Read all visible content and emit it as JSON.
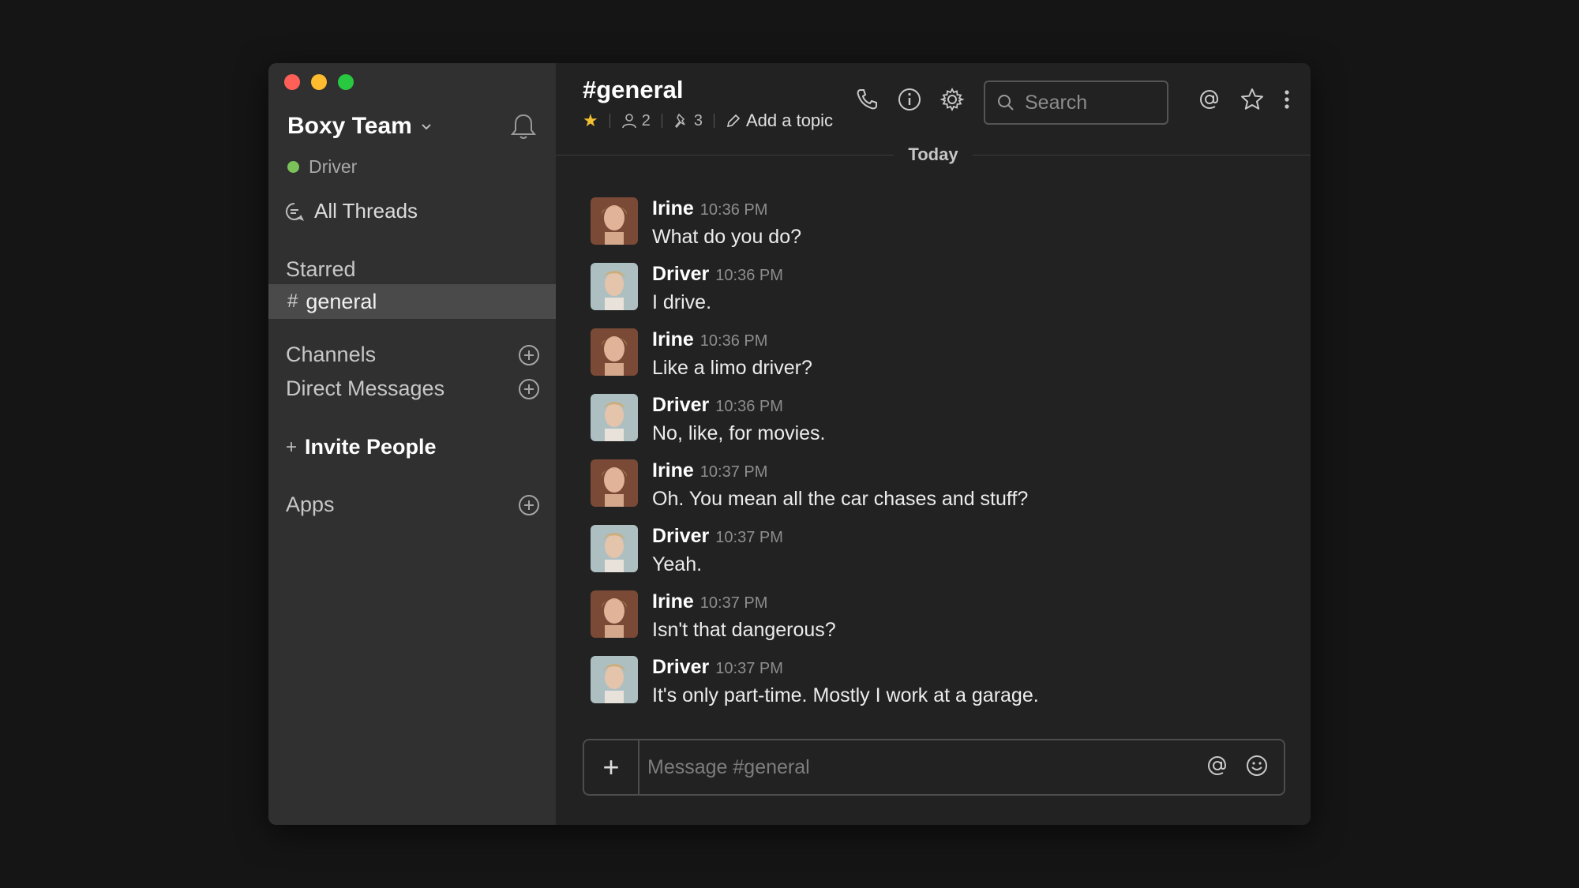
{
  "sidebar": {
    "team_name": "Boxy Team",
    "user_status": "Driver",
    "all_threads": "All Threads",
    "starred_label": "Starred",
    "active_channel": {
      "hash": "#",
      "name": "general"
    },
    "channels_label": "Channels",
    "dms_label": "Direct Messages",
    "invite_label": "Invite People",
    "invite_plus": "+",
    "apps_label": "Apps",
    "status_color": "#7bc258"
  },
  "header": {
    "channel_title": "#general",
    "member_count": "2",
    "pinned_count": "3",
    "add_topic": "Add a topic",
    "search_placeholder": "Search"
  },
  "divider_label": "Today",
  "messages": [
    {
      "author": "Irine",
      "time": "10:36 PM",
      "text": "What do you do?"
    },
    {
      "author": "Driver",
      "time": "10:36 PM",
      "text": "I drive."
    },
    {
      "author": "Irine",
      "time": "10:36 PM",
      "text": "Like a limo driver?"
    },
    {
      "author": "Driver",
      "time": "10:36 PM",
      "text": "No, like, for movies."
    },
    {
      "author": "Irine",
      "time": "10:37 PM",
      "text": "Oh. You mean all the car chases and stuff?"
    },
    {
      "author": "Driver",
      "time": "10:37 PM",
      "text": "Yeah."
    },
    {
      "author": "Irine",
      "time": "10:37 PM",
      "text": "Isn't that dangerous?"
    },
    {
      "author": "Driver",
      "time": "10:37 PM",
      "text": "It's only part-time. Mostly I work at a garage."
    }
  ],
  "composer": {
    "add_label": "+",
    "placeholder": "Message #general"
  },
  "colors": {
    "accent_star": "#f2c033",
    "window_bg": "#222222",
    "sidebar_bg": "#303030"
  }
}
